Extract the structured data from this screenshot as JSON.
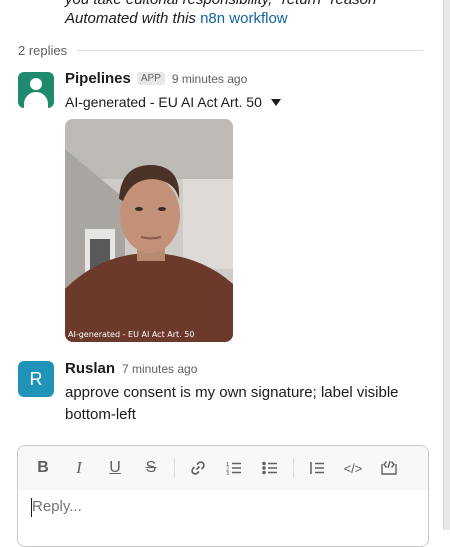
{
  "previous_message": {
    "cut_line": "you take editorial responsibility, \"return\" reason",
    "footer_prefix": "Automated with this ",
    "footer_link": "n8n workflow"
  },
  "thread": {
    "replies_label": "2 replies"
  },
  "messages": [
    {
      "sender": "Pipelines",
      "badge": "APP",
      "time": "9 minutes ago",
      "subtitle": "AI-generated - EU AI Act Art. 50",
      "image_overlay_label": "AI-generated - EU AI Act Art. 50",
      "avatar_color": "#1f8a6e"
    },
    {
      "sender": "Ruslan",
      "avatar_letter": "R",
      "avatar_color": "#1f94b8",
      "time": "7 minutes ago",
      "text": "approve consent is my own signature; label visible bottom-left"
    }
  ],
  "composer": {
    "placeholder": "Reply...",
    "toolbar": [
      {
        "icon": "bold-icon",
        "glyph": "B"
      },
      {
        "icon": "italic-icon",
        "glyph": "I"
      },
      {
        "icon": "underline-icon",
        "glyph": "U"
      },
      {
        "icon": "strikethrough-icon",
        "glyph": "S"
      },
      {
        "icon": "link-icon"
      },
      {
        "icon": "ordered-list-icon"
      },
      {
        "icon": "bulleted-list-icon"
      },
      {
        "icon": "blockquote-icon"
      },
      {
        "icon": "code-icon",
        "glyph": "</>"
      },
      {
        "icon": "code-block-icon"
      }
    ]
  },
  "colors": {
    "link": "#1264a3",
    "text": "#1d1c1d",
    "muted": "#616061"
  }
}
